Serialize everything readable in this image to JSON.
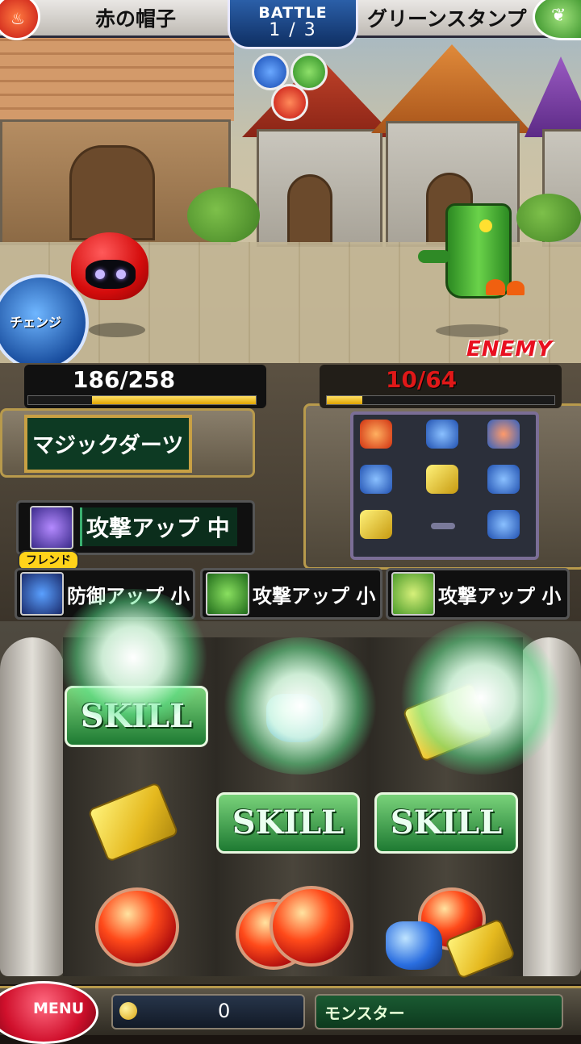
{
  "header": {
    "player_name": "赤の帽子",
    "enemy_name": "グリーンスタンプ",
    "battle_label": "BATTLE",
    "battle_count": "1 / 3"
  },
  "scene": {
    "change_label": "チェンジ",
    "enemy_label": "ENEMY"
  },
  "player_hp": {
    "text": "186/258",
    "current": 186,
    "max": 258
  },
  "enemy_hp": {
    "text": "10/64",
    "current": 10,
    "max": 64
  },
  "skill_name": "マジックダーツ",
  "buffs": {
    "friend_badge": "フレンド",
    "friend_buff": "攻撃アップ 中",
    "party": [
      {
        "label": "防御アップ 小"
      },
      {
        "label": "攻撃アップ 小"
      },
      {
        "label": "攻撃アップ 小"
      }
    ]
  },
  "slots": {
    "skill_label": "SKILL"
  },
  "bottom": {
    "menu_label": "MENU",
    "coins": "0",
    "monster_label": "モンスター"
  },
  "colors": {
    "player_element": "#e8401c",
    "enemy_element": "#3aa040",
    "accent_gold": "#c8a044"
  }
}
